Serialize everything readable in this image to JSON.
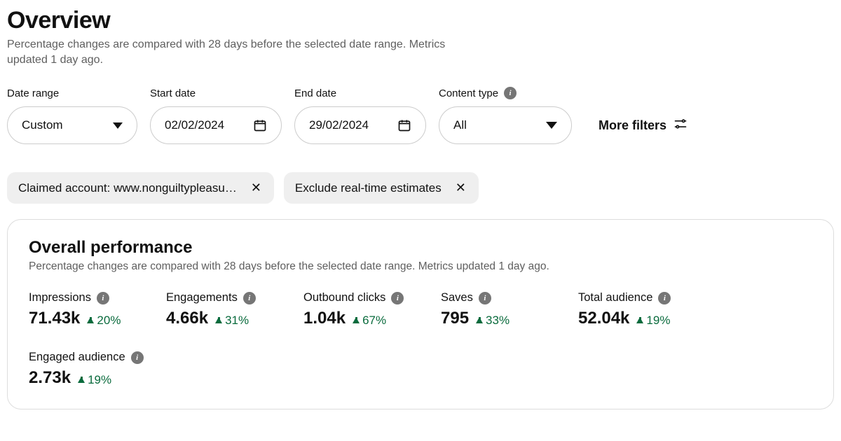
{
  "header": {
    "title": "Overview",
    "subtitle": "Percentage changes are compared with 28 days before the selected date range. Metrics updated 1 day ago."
  },
  "filters": {
    "date_range": {
      "label": "Date range",
      "value": "Custom"
    },
    "start_date": {
      "label": "Start date",
      "value": "02/02/2024"
    },
    "end_date": {
      "label": "End date",
      "value": "29/02/2024"
    },
    "content_type": {
      "label": "Content type",
      "value": "All"
    },
    "more_filters_label": "More filters"
  },
  "chips": [
    {
      "label": "Claimed account: www.nonguiltypleasu…"
    },
    {
      "label": "Exclude real-time estimates"
    }
  ],
  "card": {
    "title": "Overall performance",
    "subtitle": "Percentage changes are compared with 28 days before the selected date range. Metrics updated 1 day ago."
  },
  "metrics": [
    {
      "label": "Impressions",
      "value": "71.43k",
      "delta": "20%"
    },
    {
      "label": "Engagements",
      "value": "4.66k",
      "delta": "31%"
    },
    {
      "label": "Outbound clicks",
      "value": "1.04k",
      "delta": "67%"
    },
    {
      "label": "Saves",
      "value": "795",
      "delta": "33%"
    },
    {
      "label": "Total audience",
      "value": "52.04k",
      "delta": "19%"
    },
    {
      "label": "Engaged audience",
      "value": "2.73k",
      "delta": "19%"
    }
  ],
  "colors": {
    "positive": "#0a6b3d",
    "muted_text": "#5f5f5f",
    "chip_bg": "#efefef"
  }
}
